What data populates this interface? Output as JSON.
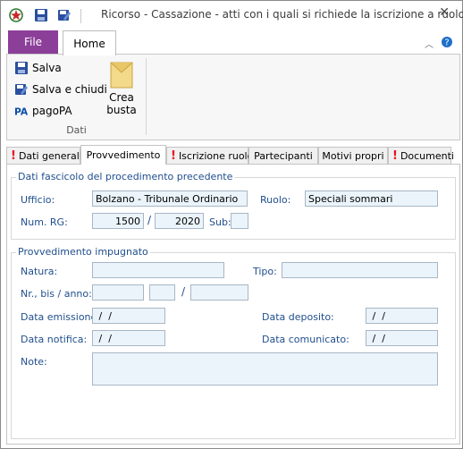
{
  "window": {
    "title": "Ricorso - Cassazione - atti con i quali si richiede la iscrizione a ruolo",
    "close_symbol": "✕"
  },
  "ribbon": {
    "tabs": {
      "file": "File",
      "home": "Home"
    },
    "buttons": {
      "salva": "Salva",
      "salva_chiudi": "Salva e chiudi",
      "pagopa": "pagoPA",
      "crea_busta": "Crea busta"
    },
    "group_label": "Dati"
  },
  "tabs": [
    {
      "label": "Dati generali",
      "warning": true
    },
    {
      "label": "Provvedimento",
      "warning": false,
      "active": true
    },
    {
      "label": "Iscrizione ruolo",
      "warning": true
    },
    {
      "label": "Partecipanti",
      "warning": false
    },
    {
      "label": "Motivi propri",
      "warning": false
    },
    {
      "label": "Documenti",
      "warning": true
    }
  ],
  "warning_symbol": "!",
  "fascicolo": {
    "legend": "Dati fascicolo del procedimento precedente",
    "ufficio_label": "Ufficio:",
    "ufficio_value": "Bolzano - Tribunale Ordinario",
    "ruolo_label": "Ruolo:",
    "ruolo_value": "Speciali sommari",
    "numrg_label": "Num. RG:",
    "numrg_value": "1500",
    "anno_value": "2020",
    "sub_label": "Sub:",
    "sub_value": ""
  },
  "provvedimento": {
    "legend": "Provvedimento impugnato",
    "natura_label": "Natura:",
    "natura_value": "",
    "tipo_label": "Tipo:",
    "tipo_value": "",
    "nr_label": "Nr., bis / anno:",
    "nr_value": "",
    "bis_value": "",
    "anno_value": "",
    "emissione_label": "Data emissione:",
    "emissione_value": " /  /",
    "deposito_label": "Data deposito:",
    "deposito_value": " /  /",
    "notifica_label": "Data notifica:",
    "notifica_value": " /  /",
    "comunicato_label": "Data comunicato:",
    "comunicato_value": " /  /",
    "note_label": "Note:",
    "note_value": ""
  },
  "colors": {
    "file_tab": "#8b3f98",
    "label_blue": "#1f4e8c",
    "input_bg": "#eaf4fa",
    "warning": "#e81123"
  }
}
